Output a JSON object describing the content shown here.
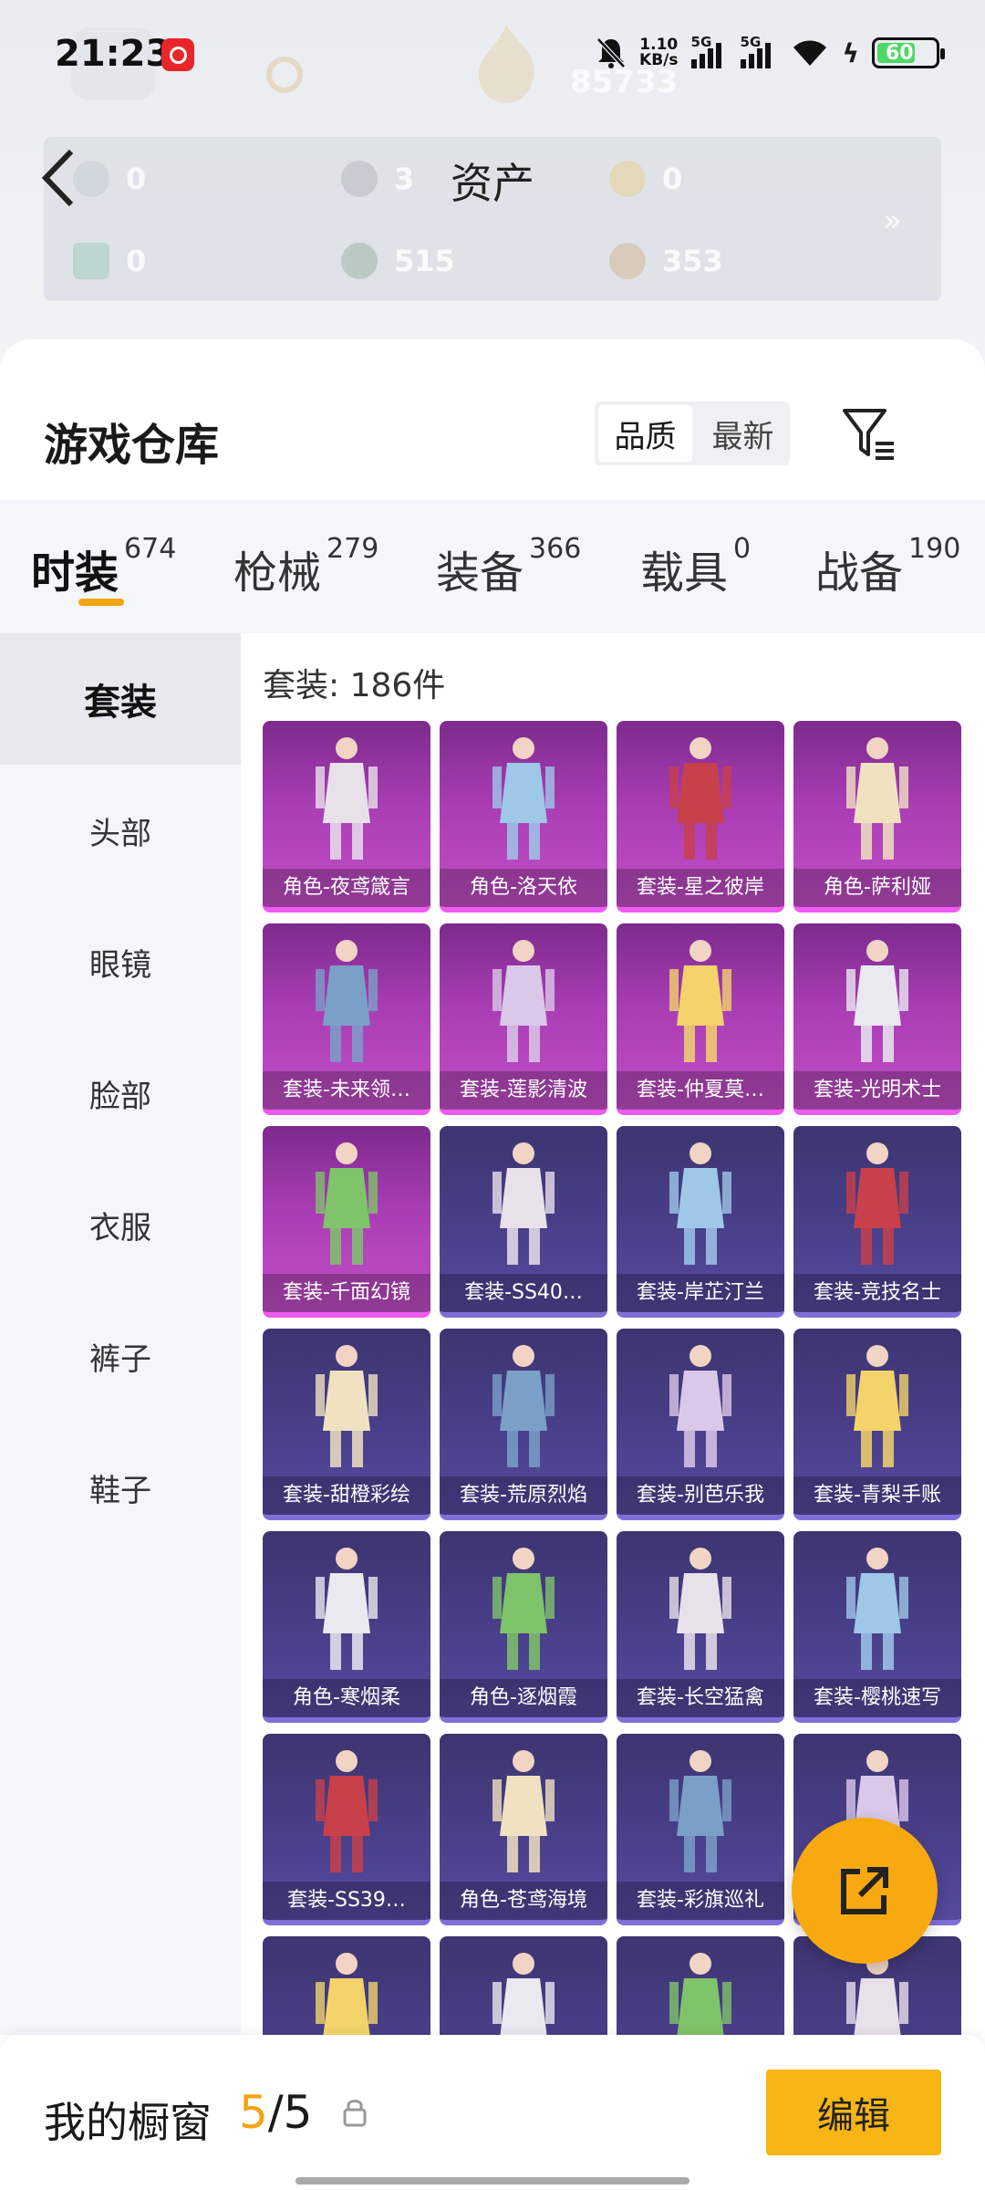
{
  "status_bar": {
    "time": "21:23",
    "net_speed_value": "1.10",
    "net_speed_unit": "KB/s",
    "sim1": "5G",
    "sim2": "5G",
    "battery": "60"
  },
  "background": {
    "score": "85733"
  },
  "assets": {
    "title": "资产",
    "items": [
      {
        "value": "0",
        "icon": "silver-token-icon"
      },
      {
        "value": "3",
        "icon": "coin-icon"
      },
      {
        "value": "0",
        "icon": "gold-token-icon"
      },
      {
        "value": "0",
        "icon": "ticket-icon"
      },
      {
        "value": "515",
        "icon": "gem-icon"
      },
      {
        "value": "353",
        "icon": "bronze-coin-icon"
      }
    ],
    "more": "»"
  },
  "warehouse": {
    "title": "游戏仓库",
    "sort": {
      "quality": "品质",
      "newest": "最新",
      "active": "quality"
    }
  },
  "tabs": [
    {
      "label": "时装",
      "count": "674",
      "active": true
    },
    {
      "label": "枪械",
      "count": "279"
    },
    {
      "label": "装备",
      "count": "366"
    },
    {
      "label": "载具",
      "count": "0"
    },
    {
      "label": "战备",
      "count": "190"
    }
  ],
  "sidebar": [
    {
      "label": "套装",
      "active": true
    },
    {
      "label": "头部"
    },
    {
      "label": "眼镜"
    },
    {
      "label": "脸部"
    },
    {
      "label": "衣服"
    },
    {
      "label": "裤子"
    },
    {
      "label": "鞋子"
    }
  ],
  "grid": {
    "count_label": "套装: 186件",
    "items": [
      {
        "name": "角色-夜鸢箴言",
        "rarity": "mythic"
      },
      {
        "name": "角色-洛天依",
        "rarity": "mythic"
      },
      {
        "name": "套装-星之彼岸",
        "rarity": "mythic"
      },
      {
        "name": "角色-萨利娅",
        "rarity": "mythic"
      },
      {
        "name": "套装-未来领…",
        "rarity": "mythic"
      },
      {
        "name": "套装-莲影清波",
        "rarity": "mythic"
      },
      {
        "name": "套装-仲夏莫…",
        "rarity": "mythic"
      },
      {
        "name": "套装-光明术士",
        "rarity": "mythic"
      },
      {
        "name": "套装-千面幻镜",
        "rarity": "mythic"
      },
      {
        "name": "套装-SS40…",
        "rarity": "legend"
      },
      {
        "name": "套装-岸芷汀兰",
        "rarity": "legend"
      },
      {
        "name": "套装-竞技名士",
        "rarity": "legend"
      },
      {
        "name": "套装-甜橙彩绘",
        "rarity": "legend"
      },
      {
        "name": "套装-荒原烈焰",
        "rarity": "legend"
      },
      {
        "name": "套装-别芭乐我",
        "rarity": "legend"
      },
      {
        "name": "套装-青梨手账",
        "rarity": "legend"
      },
      {
        "name": "角色-寒烟柔",
        "rarity": "legend"
      },
      {
        "name": "角色-逐烟霞",
        "rarity": "legend"
      },
      {
        "name": "套装-长空猛禽",
        "rarity": "legend"
      },
      {
        "name": "套装-樱桃速写",
        "rarity": "legend"
      },
      {
        "name": "套装-SS39…",
        "rarity": "legend"
      },
      {
        "name": "角色-苍鸢海境",
        "rarity": "legend"
      },
      {
        "name": "套装-彩旗巡礼",
        "rarity": "legend"
      },
      {
        "name": "",
        "rarity": "legend"
      },
      {
        "name": "",
        "rarity": "legend"
      },
      {
        "name": "",
        "rarity": "legend"
      },
      {
        "name": "",
        "rarity": "legend"
      },
      {
        "name": "",
        "rarity": "legend"
      }
    ]
  },
  "showcase": {
    "title": "我的橱窗",
    "current": "5",
    "separator": "/",
    "total": "5",
    "edit_label": "编辑"
  },
  "colors": {
    "accent": "#f7a90f",
    "mythic": "#a93db4",
    "legend": "#4a3f8a"
  }
}
